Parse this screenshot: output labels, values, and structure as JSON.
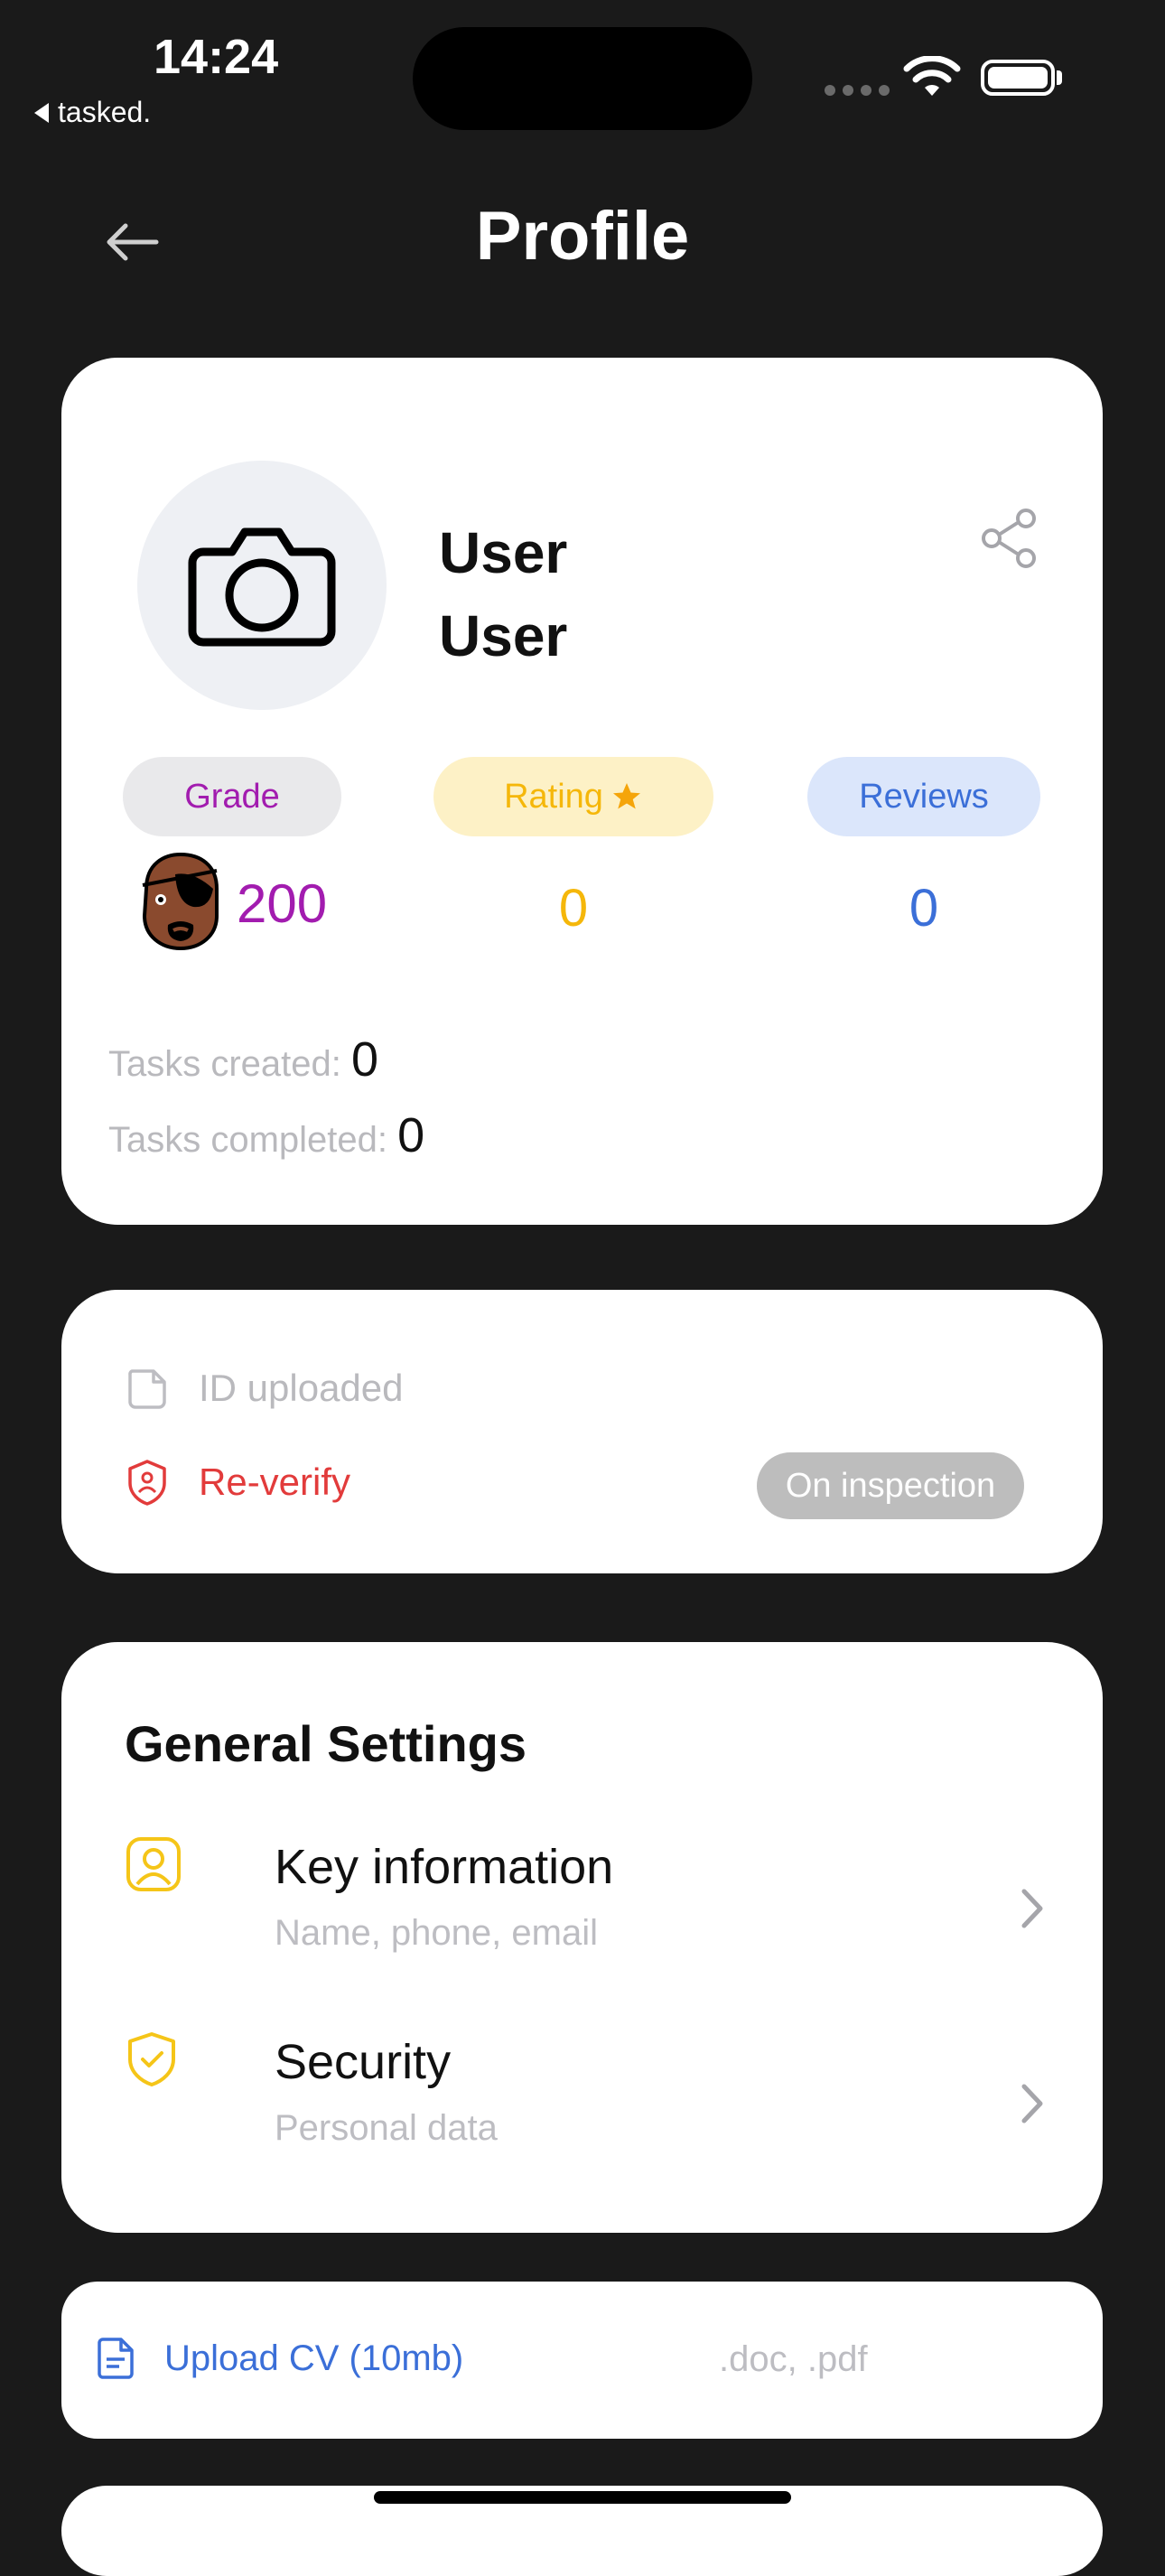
{
  "status_bar": {
    "time": "14:24",
    "back_app": "tasked.",
    "icons": [
      "signal-dots-icon",
      "wifi-icon",
      "battery-icon"
    ]
  },
  "header": {
    "title": "Profile",
    "back_icon": "arrow-left-icon"
  },
  "profile": {
    "avatar_icon": "camera-icon",
    "first_name": "User",
    "last_name": "User",
    "share_icon": "share-icon",
    "grade_label": "Grade",
    "grade_value": "200",
    "rating_label": "Rating",
    "rating_value": "0",
    "reviews_label": "Reviews",
    "reviews_value": "0",
    "tasks_created_label": "Tasks created:",
    "tasks_created_value": "0",
    "tasks_completed_label": "Tasks completed:",
    "tasks_completed_value": "0"
  },
  "verification": {
    "id_label": "ID uploaded",
    "reverify_label": "Re-verify",
    "status_badge": "On inspection"
  },
  "general_settings": {
    "title": "General Settings",
    "items": [
      {
        "label": "Key information",
        "sub": "Name, phone, email",
        "icon": "user-card-icon"
      },
      {
        "label": "Security",
        "sub": "Personal data",
        "icon": "shield-check-icon"
      }
    ]
  },
  "cv": {
    "upload_label": "Upload CV (10mb)",
    "file_types": ".doc, .pdf"
  },
  "colors": {
    "background": "#1a1a1a",
    "grade": "#a21caf",
    "rating": "#f5b70a",
    "reviews": "#3b6fd8",
    "danger": "#e23b3b",
    "settings_icon": "#f5c518"
  }
}
